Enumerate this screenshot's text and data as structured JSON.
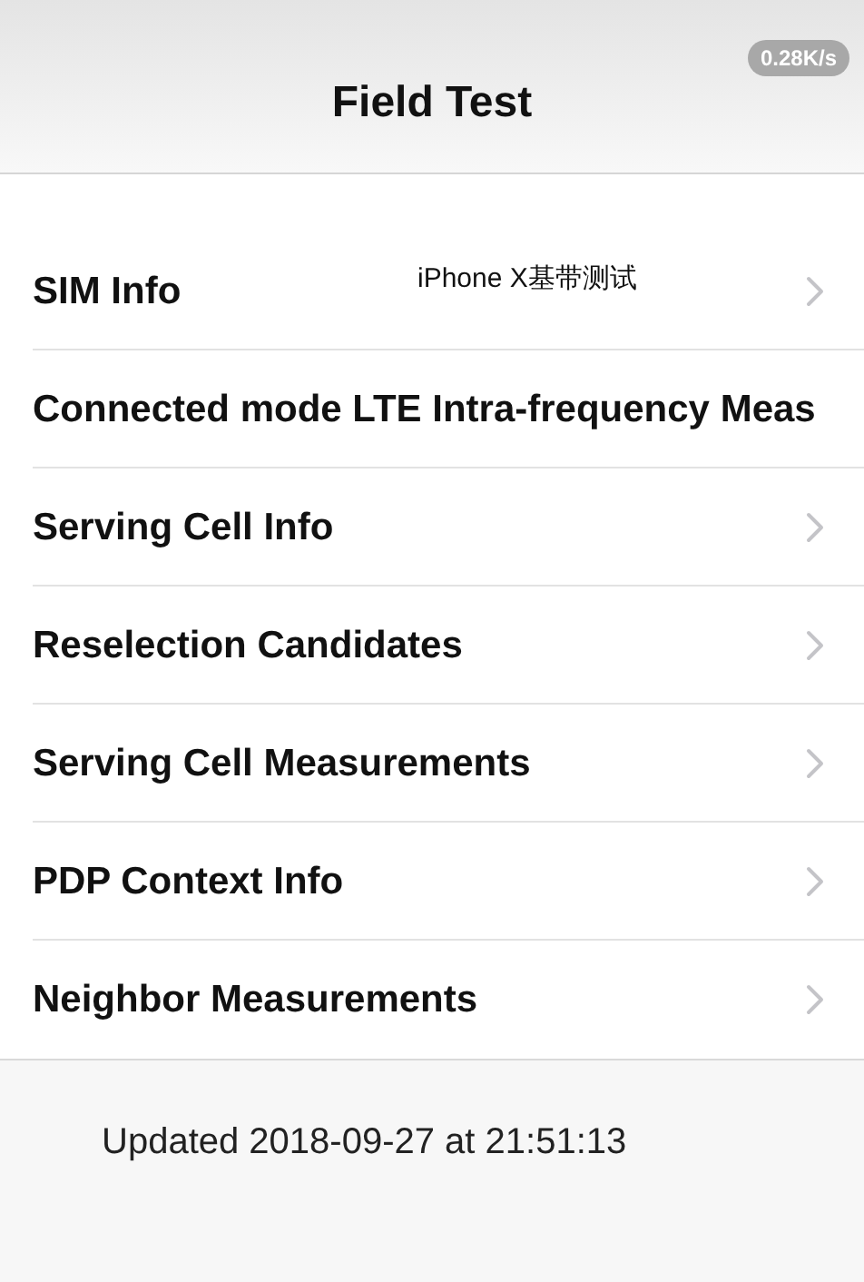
{
  "status_badge": "0.28K/s",
  "nav_title": "Field Test",
  "overlay_caption": "iPhone X基带测试",
  "items": [
    {
      "label": "SIM Info",
      "chevron": true
    },
    {
      "label": "Connected mode LTE Intra-frequency Meas",
      "chevron": false
    },
    {
      "label": "Serving Cell Info",
      "chevron": true
    },
    {
      "label": "Reselection Candidates",
      "chevron": true
    },
    {
      "label": "Serving Cell Measurements",
      "chevron": true
    },
    {
      "label": "PDP Context Info",
      "chevron": true
    },
    {
      "label": "Neighbor Measurements",
      "chevron": true
    }
  ],
  "footer": "Updated 2018-09-27 at 21:51:13"
}
